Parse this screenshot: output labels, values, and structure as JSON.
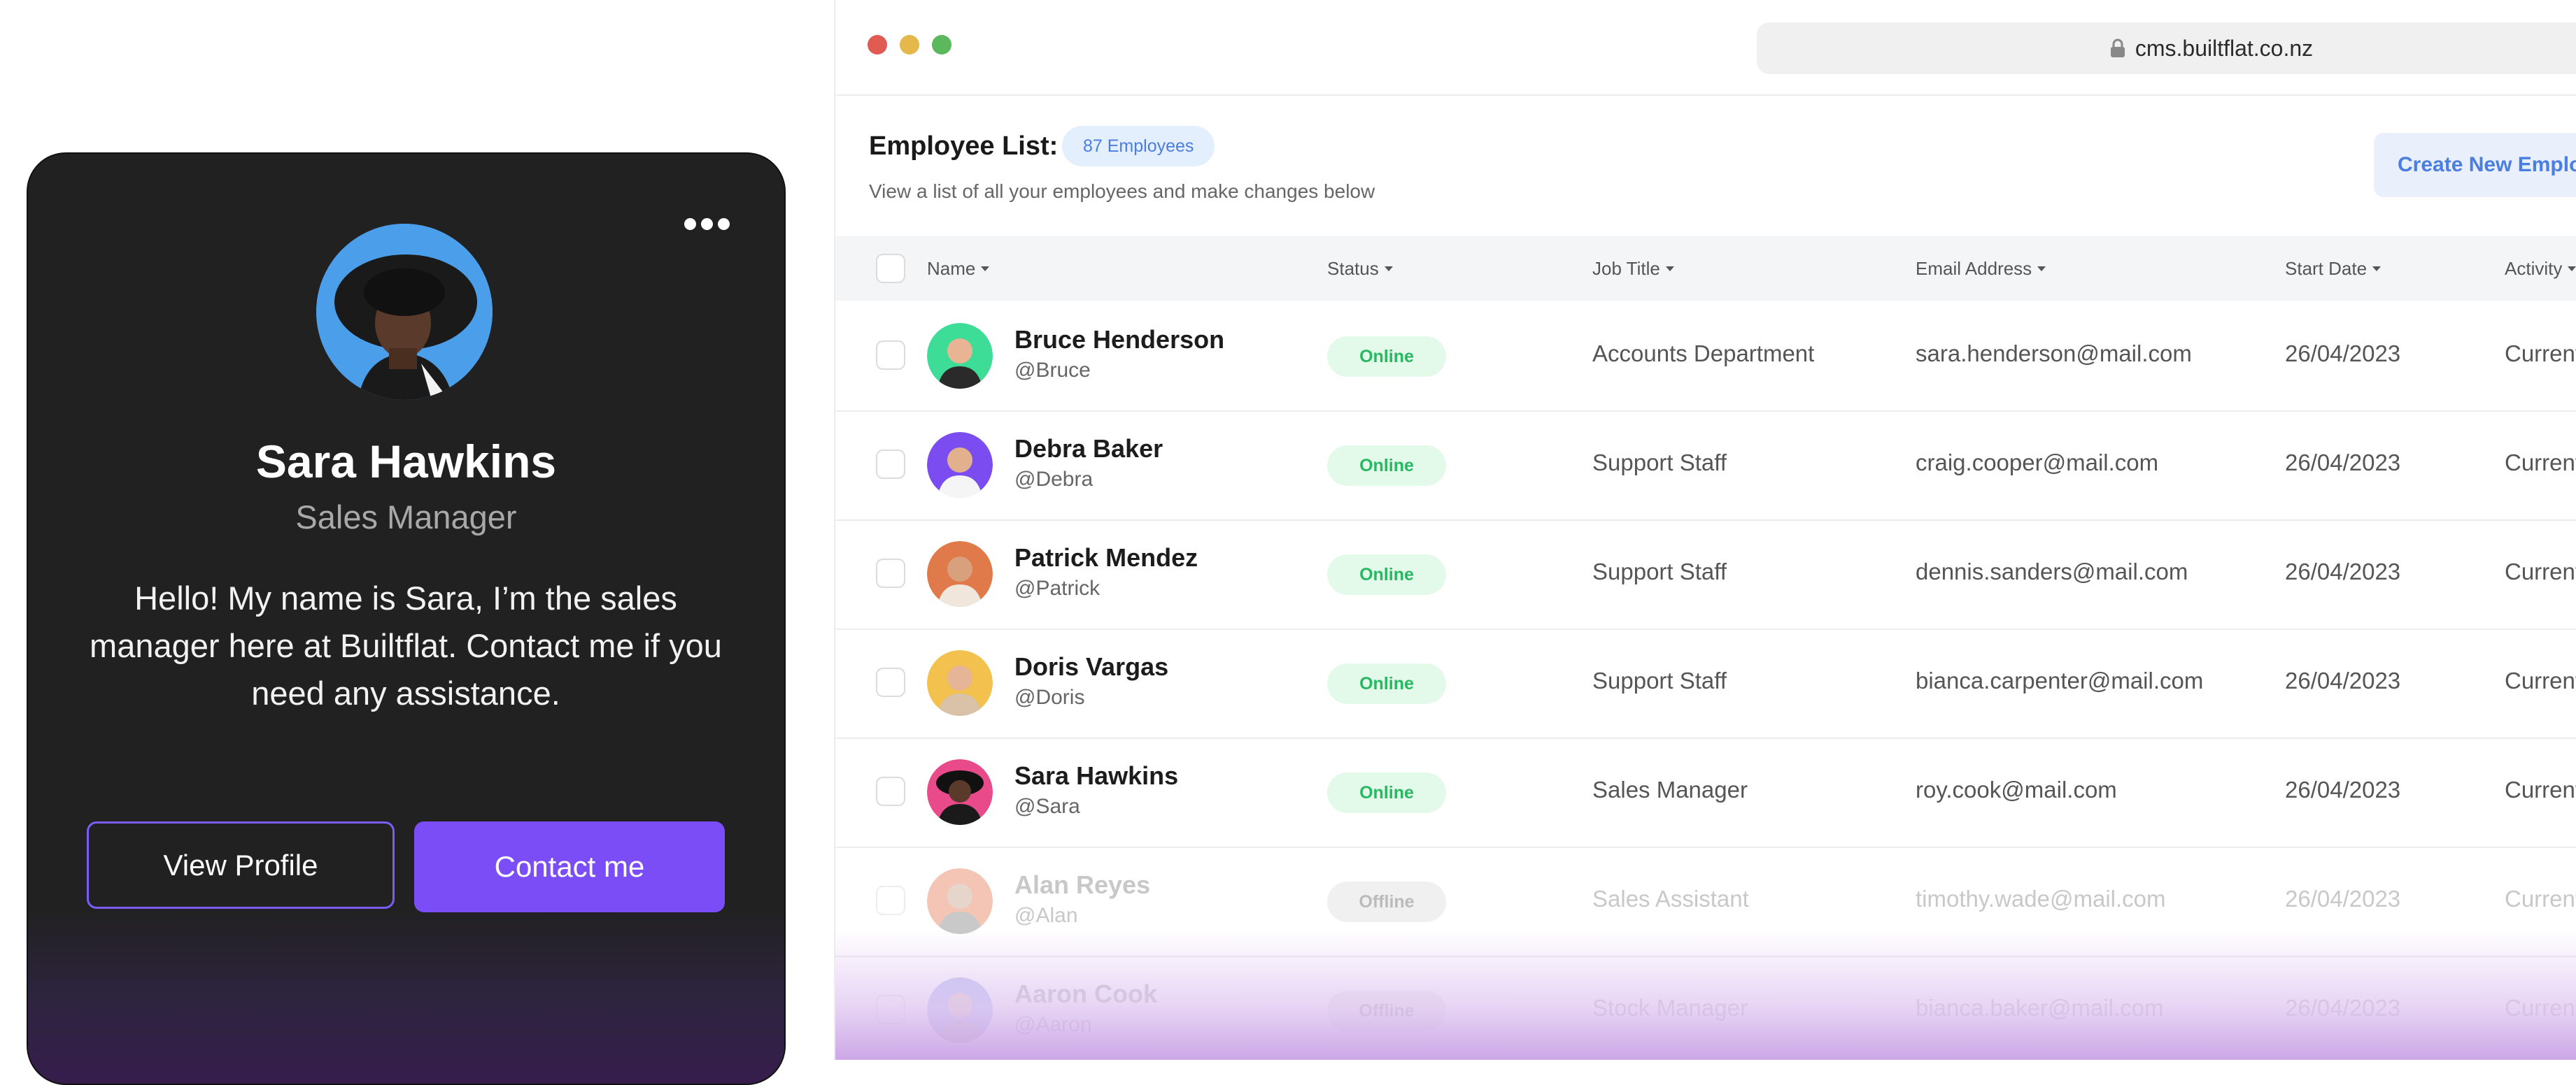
{
  "profile_card": {
    "name": "Sara Hawkins",
    "role": "Sales Manager",
    "bio": "Hello! My name is Sara, I’m the sales manager here at Builtflat. Contact me if you need any assistance.",
    "view_profile_label": "View Profile",
    "contact_label": "Contact me",
    "avatar_icon": "avatar-photo",
    "more_icon": "more-horizontal-icon"
  },
  "browser": {
    "url": "cms.builtflat.co.nz",
    "lock_icon": "lock-icon",
    "window_controls": [
      "#e05b52",
      "#e4b84a",
      "#5cb85c"
    ]
  },
  "header": {
    "title": "Employee List:",
    "badge": "87 Employees",
    "subtitle": "View a list of all your employees and make changes below",
    "create_button": "Create New Employee"
  },
  "table": {
    "columns": [
      "Name",
      "Status",
      "Job Title",
      "Email Address",
      "Start Date",
      "Activity"
    ],
    "rows": [
      {
        "name": "Bruce Henderson",
        "handle": "@Bruce",
        "status": "Online",
        "job": "Accounts Department",
        "email": "sara.henderson@mail.com",
        "start": "26/04/2023",
        "activity": "Current",
        "avatar_color": "#3ddc97"
      },
      {
        "name": "Debra Baker",
        "handle": "@Debra",
        "status": "Online",
        "job": "Support Staff",
        "email": "craig.cooper@mail.com",
        "start": "26/04/2023",
        "activity": "Current",
        "avatar_color": "#7b4df0"
      },
      {
        "name": "Patrick Mendez",
        "handle": "@Patrick",
        "status": "Online",
        "job": "Support Staff",
        "email": "dennis.sanders@mail.com",
        "start": "26/04/2023",
        "activity": "Current",
        "avatar_color": "#e07a4a"
      },
      {
        "name": "Doris Vargas",
        "handle": "@Doris",
        "status": "Online",
        "job": "Support Staff",
        "email": "bianca.carpenter@mail.com",
        "start": "26/04/2023",
        "activity": "Current",
        "avatar_color": "#f2c14e"
      },
      {
        "name": "Sara Hawkins",
        "handle": "@Sara",
        "status": "Online",
        "job": "Sales Manager",
        "email": "roy.cook@mail.com",
        "start": "26/04/2023",
        "activity": "Current",
        "avatar_color": "#e84a8a"
      },
      {
        "name": "Alan Reyes",
        "handle": "@Alan",
        "status": "Offline",
        "job": "Sales Assistant",
        "email": "timothy.wade@mail.com",
        "start": "26/04/2023",
        "activity": "Current",
        "avatar_color": "#e8805a"
      },
      {
        "name": "Aaron Cook",
        "handle": "@Aaron",
        "status": "Offline",
        "job": "Stock Manager",
        "email": "bianca.baker@mail.com",
        "start": "26/04/2023",
        "activity": "Current",
        "avatar_color": "#7a8be8"
      }
    ]
  }
}
